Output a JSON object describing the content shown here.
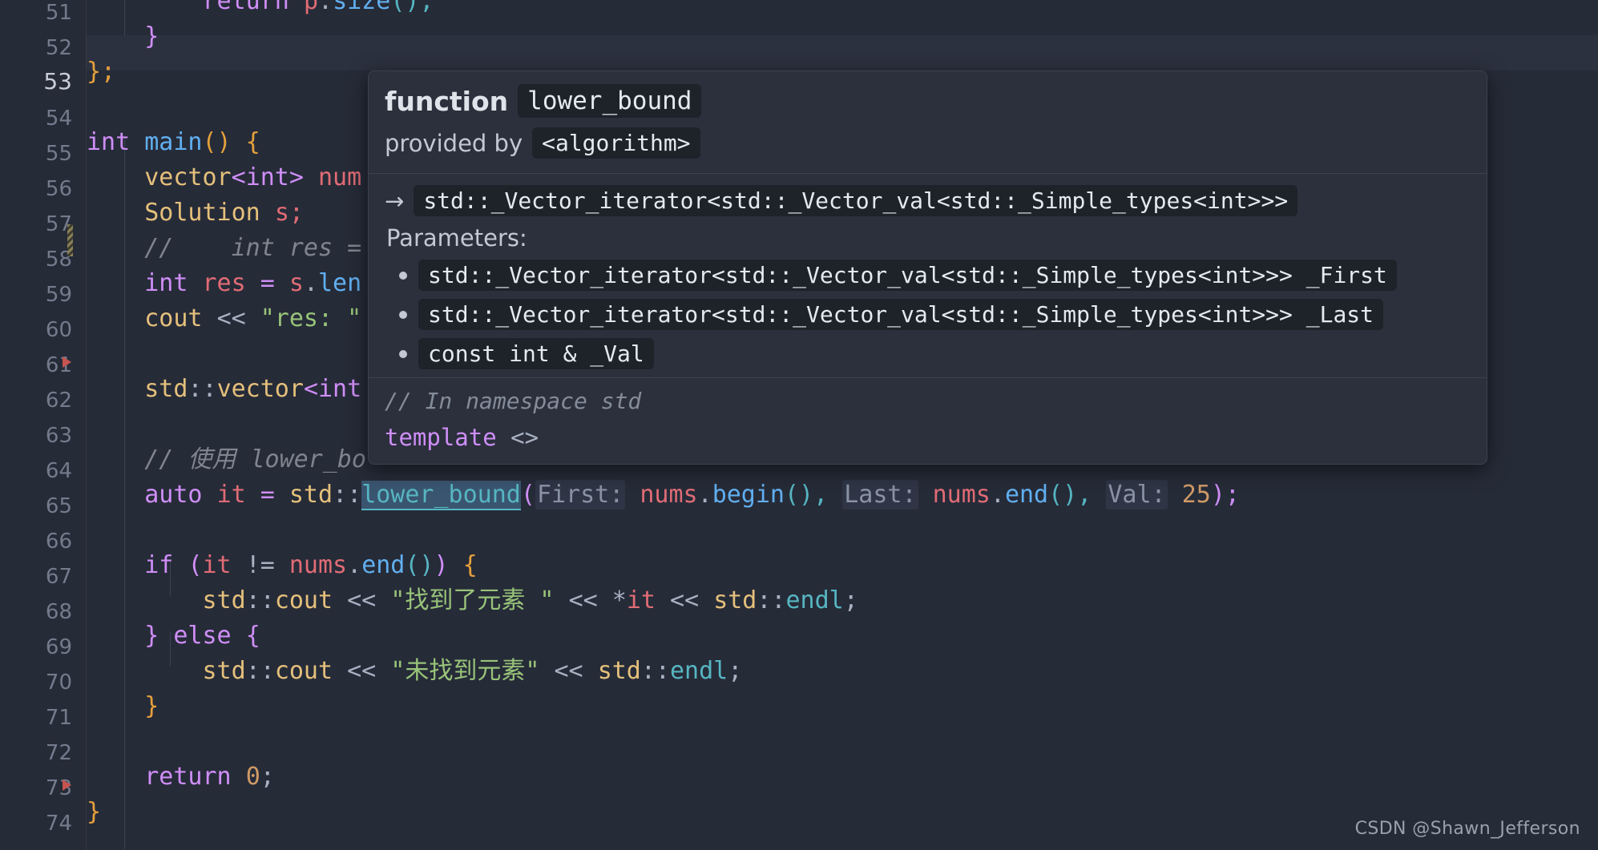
{
  "editor": {
    "background": "#262b38",
    "current_line": 53,
    "first_visible_line": 51,
    "last_visible_line": 74,
    "lines": [
      {
        "n": 51,
        "text": "        return p.size();"
      },
      {
        "n": 52,
        "text": "    }"
      },
      {
        "n": 53,
        "text": "};"
      },
      {
        "n": 54,
        "text": ""
      },
      {
        "n": 55,
        "text": "int main() {"
      },
      {
        "n": 56,
        "text": "    vector<int> num"
      },
      {
        "n": 57,
        "text": "    Solution s;"
      },
      {
        "n": 58,
        "text": "    //    int res ="
      },
      {
        "n": 59,
        "text": "    int res = s.len"
      },
      {
        "n": 60,
        "text": "    cout << \"res: \""
      },
      {
        "n": 61,
        "text": ""
      },
      {
        "n": 62,
        "text": "    std::vector<int"
      },
      {
        "n": 63,
        "text": ""
      },
      {
        "n": 64,
        "text": "    // 使用 lower_bo"
      },
      {
        "n": 65,
        "text": "    auto it = std::lower_bound(First: nums.begin(), Last: nums.end(), Val: 25);"
      },
      {
        "n": 66,
        "text": ""
      },
      {
        "n": 67,
        "text": "    if (it != nums.end()) {"
      },
      {
        "n": 68,
        "text": "        std::cout << \"找到了元素 \" << *it << std::endl;"
      },
      {
        "n": 69,
        "text": "    } else {"
      },
      {
        "n": 70,
        "text": "        std::cout << \"未找到元素\" << std::endl;"
      },
      {
        "n": 71,
        "text": "    }"
      },
      {
        "n": 72,
        "text": ""
      },
      {
        "n": 73,
        "text": "    return 0;"
      },
      {
        "n": 74,
        "text": "}"
      }
    ],
    "gutter_markers": {
      "run_marker_lines": [
        62,
        74
      ],
      "change_marker_lines": [
        58
      ]
    }
  },
  "code_tokens": {
    "l51_return": "return",
    "l51_p": "p",
    "l51_dot": ".",
    "l51_size": "size",
    "l51_tail": "();",
    "l52_brace": "}",
    "l53_brace": "};",
    "l55_int": "int",
    "l55_main": "main",
    "l55_parens": "()",
    "l55_brace": "{",
    "l56_vector": "vector",
    "l56_lt": "<",
    "l56_int": "int",
    "l56_gt": ">",
    "l56_num": "num",
    "l57_solution": "Solution",
    "l57_s": "s;",
    "l58_comment": "//    int res =",
    "l59_int": "int",
    "l59_res": "res",
    "l59_eq": "=",
    "l59_s": "s",
    "l59_dot": ".",
    "l59_len": "len",
    "l60_cout": "cout",
    "l60_shift": "<<",
    "l60_str": "\"res: \"",
    "l62_std": "std",
    "l62_colons": "::",
    "l62_vector": "vector",
    "l62_lt": "<",
    "l62_int": "int",
    "l64_comment": "// 使用 lower_bo",
    "l65_auto": "auto",
    "l65_it": "it",
    "l65_eq": "=",
    "l65_std": "std",
    "l65_colons": "::",
    "l65_lower_bound": "lower_bound",
    "l65_lparen": "(",
    "l65_hint_first": "First:",
    "l65_nums1": "nums",
    "l65_dot1": ".",
    "l65_begin": "begin",
    "l65_p1": "(),",
    "l65_hint_last": "Last:",
    "l65_nums2": "nums",
    "l65_dot2": ".",
    "l65_end": "end",
    "l65_p2": "(),",
    "l65_hint_val": "Val:",
    "l65_25": "25",
    "l65_tail": ");",
    "l67_if": "if",
    "l67_lp": "(",
    "l67_it": "it",
    "l67_ne": "!=",
    "l67_nums": "nums",
    "l67_dot": ".",
    "l67_end": "end",
    "l67_p": "()",
    "l67_rp": ")",
    "l67_brace": "{",
    "l68_std": "std",
    "l68_colons": "::",
    "l68_cout": "cout",
    "l68_sh1": "<<",
    "l68_str": "\"找到了元素 \"",
    "l68_sh2": "<<",
    "l68_star": "*",
    "l68_it": "it",
    "l68_sh3": "<<",
    "l68_std2": "std",
    "l68_colons2": "::",
    "l68_endl": "endl",
    "l68_semi": ";",
    "l69_rb": "}",
    "l69_else": "else",
    "l69_lb": "{",
    "l70_std": "std",
    "l70_colons": "::",
    "l70_cout": "cout",
    "l70_sh1": "<<",
    "l70_str": "\"未找到元素\"",
    "l70_sh2": "<<",
    "l70_std2": "std",
    "l70_colons2": "::",
    "l70_endl": "endl",
    "l70_semi": ";",
    "l71_brace": "}",
    "l73_return": "return",
    "l73_zero": "0",
    "l73_semi": ";",
    "l74_brace": "}"
  },
  "tooltip": {
    "kind_label": "function",
    "symbol": "lower_bound",
    "provided_by_label": "provided by",
    "header_include": "<algorithm>",
    "return_arrow": "→",
    "return_type": "std::_Vector_iterator<std::_Vector_val<std::_Simple_types<int>>>",
    "parameters_label": "Parameters:",
    "parameters": [
      "std::_Vector_iterator<std::_Vector_val<std::_Simple_types<int>>> _First",
      "std::_Vector_iterator<std::_Vector_val<std::_Simple_types<int>>> _Last",
      "const int & _Val"
    ],
    "namespace_comment": "// In namespace std",
    "template_keyword": "template",
    "template_rest": " <>"
  },
  "watermark": {
    "text": "CSDN @Shawn_Jefferson"
  }
}
